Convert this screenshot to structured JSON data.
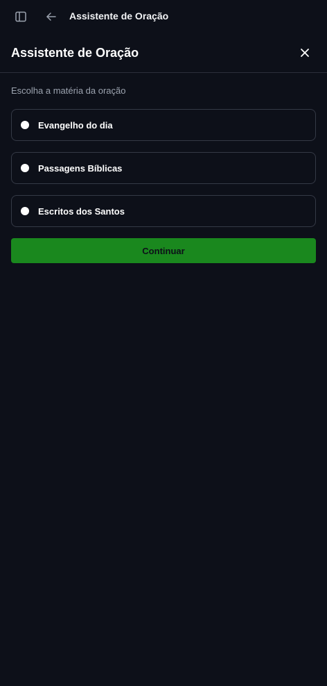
{
  "topbar": {
    "sidebar_icon": "sidebar-panel-icon",
    "back_icon": "arrow-left-icon",
    "title": "Assistente de Oração"
  },
  "panel": {
    "title": "Assistente de Oração",
    "close_icon": "close-icon",
    "subtitle": "Escolha a matéria da oração"
  },
  "options": [
    {
      "label": "Evangelho do dia"
    },
    {
      "label": "Passagens Bíblicas"
    },
    {
      "label": "Escritos dos Santos"
    }
  ],
  "actions": {
    "continue_label": "Continuar"
  },
  "colors": {
    "background": "#0d1019",
    "border": "#353a46",
    "accent": "#1a881e",
    "muted_text": "#9ca3af"
  }
}
